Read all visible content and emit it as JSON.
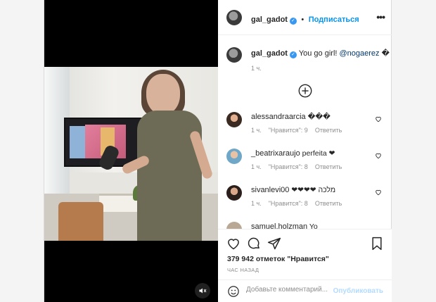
{
  "post": {
    "username": "gal_gadot",
    "follow_label": "Подписаться",
    "more_label": "•••"
  },
  "caption": {
    "username": "gal_gadot",
    "text": "You go girl! ",
    "mention": "@nogaerez",
    "emoji": "�",
    "time": "1 ч."
  },
  "comments": [
    {
      "username": "alessandraarcia",
      "text": "���",
      "time": "1 ч.",
      "likes": "\"Нравится\": 9",
      "reply": "Ответить"
    },
    {
      "username": "_beatrixaraujo",
      "text": "perfeita ❤",
      "time": "1 ч.",
      "likes": "\"Нравится\": 8",
      "reply": "Ответить"
    },
    {
      "username": "sivanlevi00",
      "text": "❤❤❤❤ מלכה",
      "time": "1 ч.",
      "likes": "\"Нравится\": 8",
      "reply": "Ответить"
    },
    {
      "username": "samuel.holzman",
      "text": "Yo"
    }
  ],
  "footer": {
    "likes_text": "379 942 отметок \"Нравится\"",
    "ago_text": "ЧАС НАЗАД",
    "comment_placeholder": "Добавьте комментарий...",
    "publish_label": "Опубликовать"
  }
}
